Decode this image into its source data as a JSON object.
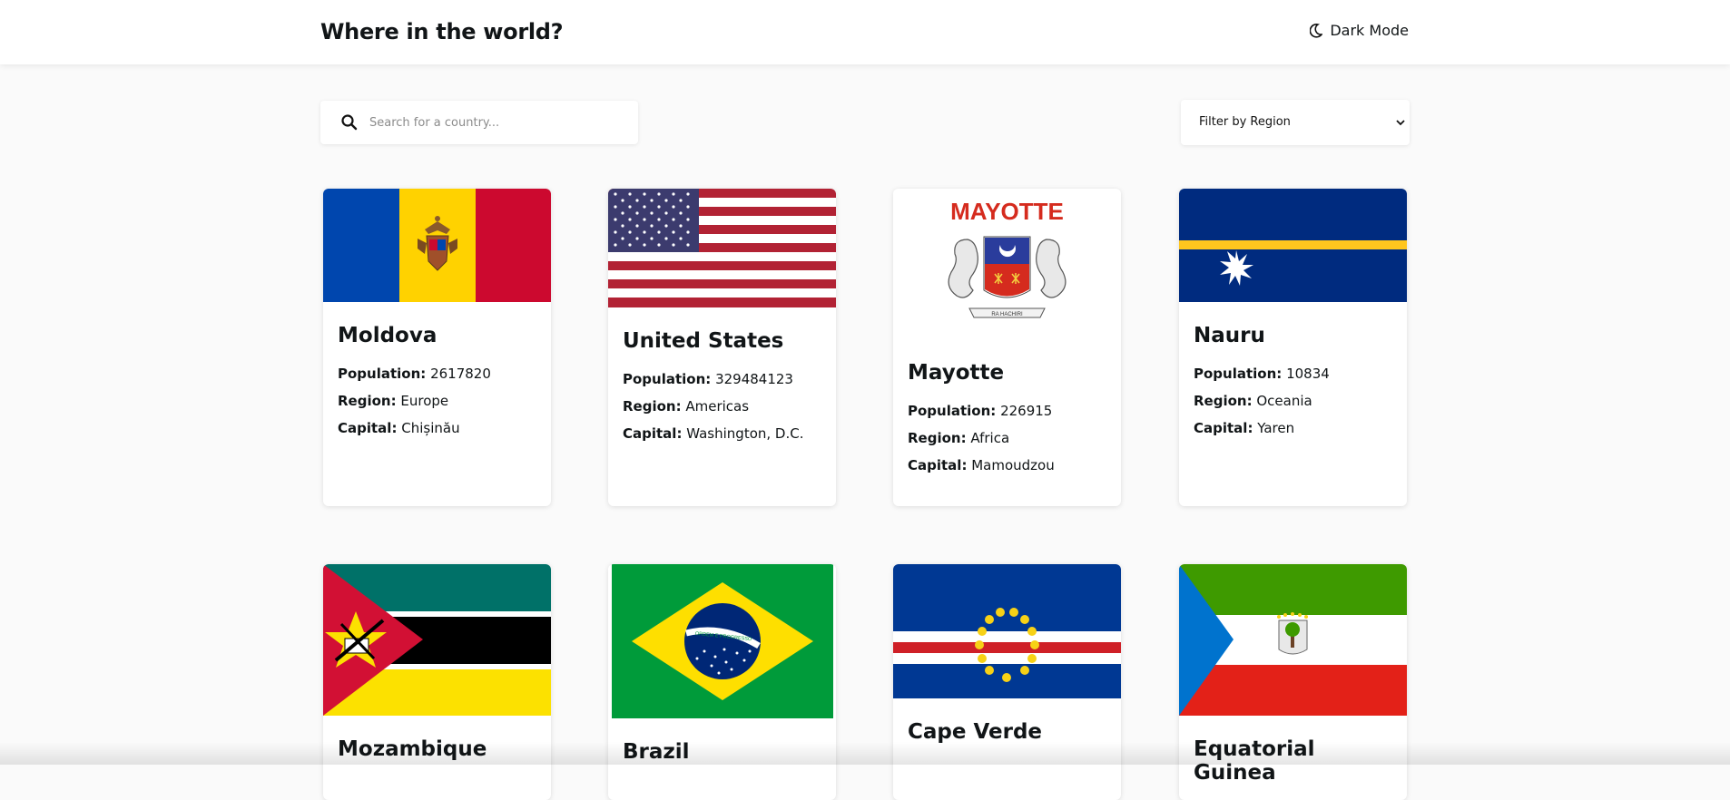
{
  "header": {
    "title": "Where in the world?",
    "mode_label": "Dark Mode",
    "mode_icon": "moon-icon"
  },
  "search": {
    "placeholder": "Search for a country...",
    "value": "",
    "icon": "search-icon"
  },
  "filter": {
    "selected": "Filter by Region",
    "icon": "chevron-down-icon"
  },
  "labels": {
    "population": "Population:",
    "region": "Region:",
    "capital": "Capital:"
  },
  "colors": {
    "background": "#fafafa",
    "card": "#ffffff",
    "text": "#111517"
  },
  "countries": [
    {
      "name": "Moldova",
      "population": "2617820",
      "region": "Europe",
      "capital": "Chișinău"
    },
    {
      "name": "United States",
      "population": "329484123",
      "region": "Americas",
      "capital": "Washington, D.C."
    },
    {
      "name": "Mayotte",
      "population": "226915",
      "region": "Africa",
      "capital": "Mamoudzou",
      "flag_text": "MAYOTTE",
      "flag_motto": "RA HACHIRI"
    },
    {
      "name": "Nauru",
      "population": "10834",
      "region": "Oceania",
      "capital": "Yaren"
    },
    {
      "name": "Mozambique"
    },
    {
      "name": "Brazil",
      "flag_motto": "ORDEM E PROGRESSO"
    },
    {
      "name": "Cape Verde"
    },
    {
      "name": "Equatorial Guinea"
    }
  ]
}
